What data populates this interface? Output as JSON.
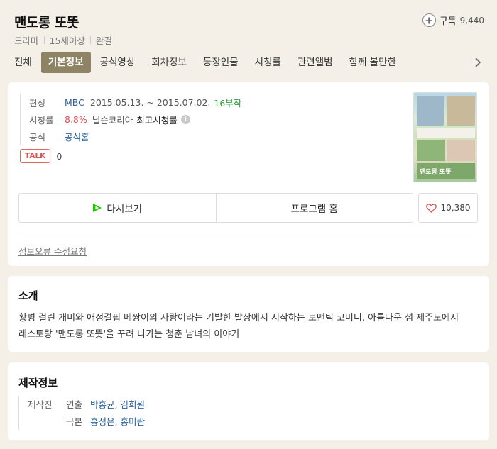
{
  "header": {
    "title": "맨도롱 또똣",
    "meta": [
      "드라마",
      "15세이상",
      "완결"
    ],
    "subscribe_label": "구독",
    "subscribe_count": "9,440"
  },
  "tabs": [
    "전체",
    "기본정보",
    "공식영상",
    "회차정보",
    "등장인물",
    "시청률",
    "관련앨범",
    "함께 볼만한"
  ],
  "active_tab": "기본정보",
  "info": {
    "broadcast_label": "편성",
    "channel": "MBC",
    "period": "2015.05.13. ~ 2015.07.02.",
    "episodes": "16부작",
    "rating_label": "시청률",
    "rating_value": "8.8%",
    "rating_source": "닐슨코리아",
    "rating_type": "최고시청률",
    "info_icon": "i",
    "official_label": "공식",
    "official_link": "공식홈"
  },
  "talk": {
    "badge": "TALK",
    "count": "0"
  },
  "poster": {
    "title_text": "맨도롱 또똣",
    "icon": "poster-image"
  },
  "actions": {
    "replay_label": "다시보기",
    "program_home_label": "프로그램 홈",
    "like_count": "10,380"
  },
  "report_link": "정보오류 수정요청",
  "intro": {
    "title": "소개",
    "text": "황병 걸린 개미와 애정결핍 베짱이의 사랑이라는 기발한 발상에서 시작하는 로맨틱 코미디. 아름다운 섬 제주도에서 레스토랑 '맨도롱 또똣'을 꾸려 나가는 청춘 남녀의 이야기"
  },
  "production": {
    "title": "제작정보",
    "staff_label": "제작진",
    "director_label": "연출",
    "directors": "박홍균, 김희원",
    "writer_label": "극본",
    "writers": "홍정은, 홍미란"
  },
  "colors": {
    "active_tab_bg": "#8f8366",
    "link": "#2a5f99",
    "episodes_green": "#2e9e3f",
    "rating_red": "#d9534f",
    "talk_red": "#e0504b",
    "replay_icon_green": "#1ec800"
  }
}
